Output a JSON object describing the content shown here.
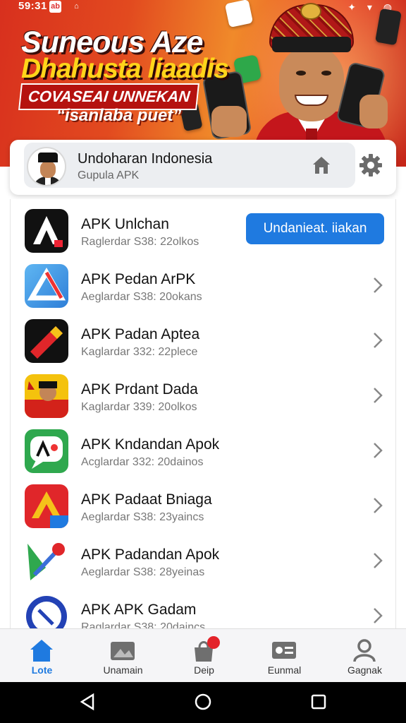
{
  "status_bar": {
    "time": "59:31",
    "icon_1": "ab",
    "icon_2": "",
    "right_icons": "wifi-signal-battery"
  },
  "banner": {
    "line_1": "Suneous Aze",
    "line_2": "Dhahusta liaadis",
    "line_3": "COVASEAI UNNEKAN",
    "line_4": "“isanlaba puet”"
  },
  "header": {
    "title": "Undoharan Indonesia",
    "subtitle": "Gupula APK"
  },
  "apps": [
    {
      "name": "APK Unlchan",
      "meta": "Raglerdar S38: 22olkos",
      "action": "Undanieat. iiakan"
    },
    {
      "name": "APK Pedan ArPK",
      "meta": "Aeglardar S38: 20okans"
    },
    {
      "name": "APK Padan Aptea",
      "meta": "Kaglardar 332: 22plece"
    },
    {
      "name": "APK Prdant Dada",
      "meta": "Kaglardar 339: 20olkos"
    },
    {
      "name": "APK Kndandan Apok",
      "meta": "Acglardar 332: 20dainos"
    },
    {
      "name": "APK Padaat Bniaga",
      "meta": "Aeglardar S38: 23yaincs"
    },
    {
      "name": "APK Padandan Apok",
      "meta": "Aeglardar S38: 28yeinas"
    },
    {
      "name": "APK APK Gadam",
      "meta": "Raglardar S38: 20daincs"
    }
  ],
  "bottom_nav": [
    {
      "label": "Lote",
      "icon": "home-icon",
      "active": true
    },
    {
      "label": "Unamain",
      "icon": "image-folder-icon"
    },
    {
      "label": "Deip",
      "icon": "bag-icon",
      "badge": true
    },
    {
      "label": "Eunmal",
      "icon": "id-card-icon"
    },
    {
      "label": "Gagnak",
      "icon": "profile-icon"
    }
  ],
  "colors": {
    "accent": "#1f7ae0",
    "banner_red": "#d8301e",
    "banner_yellow": "#ffd51a",
    "badge": "#e3232a"
  }
}
